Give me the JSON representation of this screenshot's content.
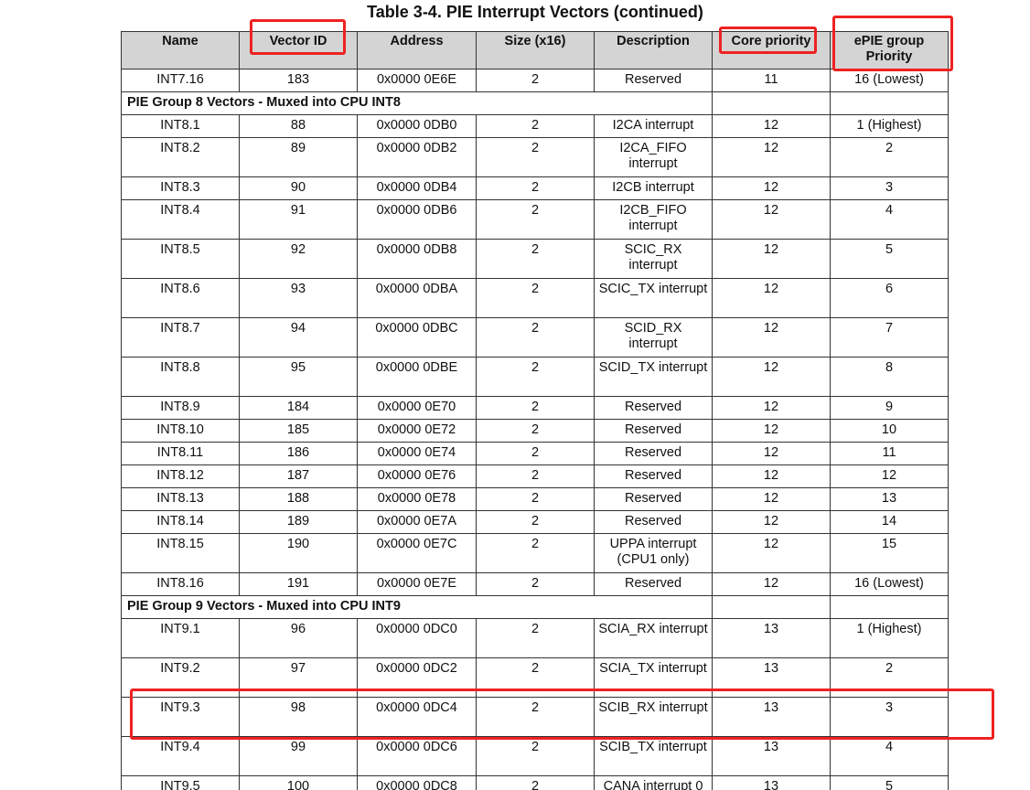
{
  "title": "Table 3-4. PIE Interrupt Vectors (continued)",
  "columns": [
    "Name",
    "Vector ID",
    "Address",
    "Size (x16)",
    "Description",
    "Core priority",
    "ePIE group Priority"
  ],
  "rows": [
    {
      "type": "vector",
      "cells": [
        "INT7.16",
        "183",
        "0x0000 0E6E",
        "2",
        "Reserved",
        "11",
        "16 (Lowest)"
      ]
    },
    {
      "type": "group",
      "label": "PIE Group 8 Vectors - Muxed into CPU INT8"
    },
    {
      "type": "vector",
      "cells": [
        "INT8.1",
        "88",
        "0x0000 0DB0",
        "2",
        "I2CA interrupt",
        "12",
        "1 (Highest)"
      ]
    },
    {
      "type": "vector",
      "cells": [
        "INT8.2",
        "89",
        "0x0000 0DB2",
        "2",
        "I2CA_FIFO interrupt",
        "12",
        "2"
      ]
    },
    {
      "type": "vector",
      "cells": [
        "INT8.3",
        "90",
        "0x0000 0DB4",
        "2",
        "I2CB interrupt",
        "12",
        "3"
      ]
    },
    {
      "type": "vector",
      "cells": [
        "INT8.4",
        "91",
        "0x0000 0DB6",
        "2",
        "I2CB_FIFO interrupt",
        "12",
        "4"
      ]
    },
    {
      "type": "vector",
      "cells": [
        "INT8.5",
        "92",
        "0x0000 0DB8",
        "2",
        "SCIC_RX interrupt",
        "12",
        "5"
      ]
    },
    {
      "type": "vector",
      "cells": [
        "INT8.6",
        "93",
        "0x0000 0DBA",
        "2",
        "SCIC_TX interrupt",
        "12",
        "6"
      ]
    },
    {
      "type": "vector",
      "cells": [
        "INT8.7",
        "94",
        "0x0000 0DBC",
        "2",
        "SCID_RX interrupt",
        "12",
        "7"
      ]
    },
    {
      "type": "vector",
      "cells": [
        "INT8.8",
        "95",
        "0x0000 0DBE",
        "2",
        "SCID_TX interrupt",
        "12",
        "8"
      ]
    },
    {
      "type": "vector",
      "cells": [
        "INT8.9",
        "184",
        "0x0000 0E70",
        "2",
        "Reserved",
        "12",
        "9"
      ]
    },
    {
      "type": "vector",
      "cells": [
        "INT8.10",
        "185",
        "0x0000 0E72",
        "2",
        "Reserved",
        "12",
        "10"
      ]
    },
    {
      "type": "vector",
      "cells": [
        "INT8.11",
        "186",
        "0x0000 0E74",
        "2",
        "Reserved",
        "12",
        "11"
      ]
    },
    {
      "type": "vector",
      "cells": [
        "INT8.12",
        "187",
        "0x0000 0E76",
        "2",
        "Reserved",
        "12",
        "12"
      ]
    },
    {
      "type": "vector",
      "cells": [
        "INT8.13",
        "188",
        "0x0000 0E78",
        "2",
        "Reserved",
        "12",
        "13"
      ]
    },
    {
      "type": "vector",
      "cells": [
        "INT8.14",
        "189",
        "0x0000 0E7A",
        "2",
        "Reserved",
        "12",
        "14"
      ]
    },
    {
      "type": "vector",
      "cells": [
        "INT8.15",
        "190",
        "0x0000 0E7C",
        "2",
        "UPPA interrupt (CPU1 only)",
        "12",
        "15"
      ]
    },
    {
      "type": "vector",
      "cells": [
        "INT8.16",
        "191",
        "0x0000 0E7E",
        "2",
        "Reserved",
        "12",
        "16 (Lowest)"
      ]
    },
    {
      "type": "group",
      "label": "PIE Group 9 Vectors - Muxed into CPU INT9"
    },
    {
      "type": "vector",
      "cells": [
        "INT9.1",
        "96",
        "0x0000 0DC0",
        "2",
        "SCIA_RX interrupt",
        "13",
        "1 (Highest)"
      ]
    },
    {
      "type": "vector",
      "cells": [
        "INT9.2",
        "97",
        "0x0000 0DC2",
        "2",
        "SCIA_TX interrupt",
        "13",
        "2"
      ]
    },
    {
      "type": "vector",
      "cells": [
        "INT9.3",
        "98",
        "0x0000 0DC4",
        "2",
        "SCIB_RX interrupt",
        "13",
        "3"
      ]
    },
    {
      "type": "vector",
      "cells": [
        "INT9.4",
        "99",
        "0x0000 0DC6",
        "2",
        "SCIB_TX interrupt",
        "13",
        "4"
      ]
    },
    {
      "type": "vector",
      "cells": [
        "INT9.5",
        "100",
        "0x0000 0DC8",
        "2",
        "CANA interrupt 0",
        "13",
        "5"
      ]
    }
  ],
  "highlight_color": "#ee2222",
  "header_background": "#d4d4d4"
}
